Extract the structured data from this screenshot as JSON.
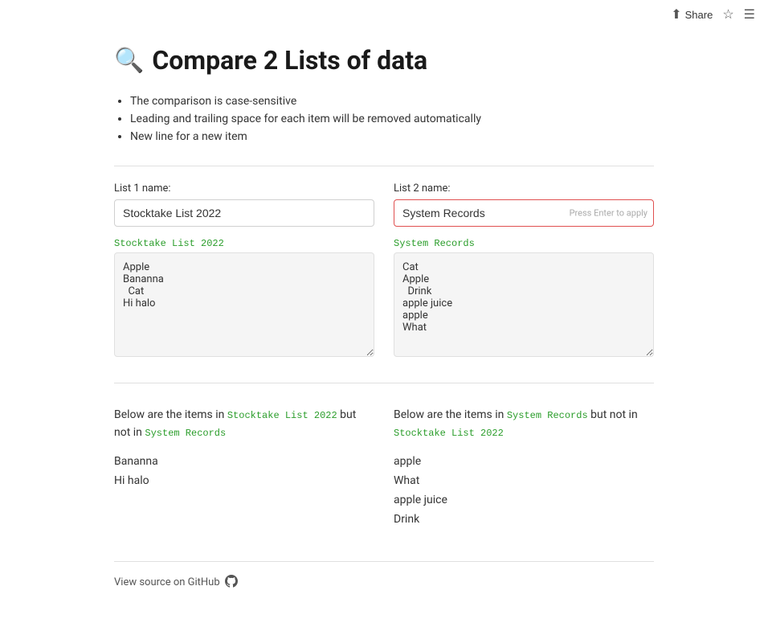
{
  "topbar": {
    "share_label": "Share",
    "share_icon": "⬆",
    "star_icon": "☆",
    "menu_icon": "☰"
  },
  "page": {
    "title_icon": "🔍",
    "title": "Compare 2 Lists of data"
  },
  "instructions": [
    "The comparison is case-sensitive",
    "Leading and trailing space for each item will be removed automatically",
    "New line for a new item"
  ],
  "list1": {
    "label": "List 1 name:",
    "name_value": "Stocktake List 2022",
    "tag": "Stocktake List 2022",
    "textarea_value": "Apple\nBananna\n  Cat\nHi halo"
  },
  "list2": {
    "label": "List 2 name:",
    "name_value": "System Records",
    "tag": "System Records",
    "press_enter": "Press Enter to apply",
    "textarea_value": "Cat\nApple\n  Drink\napple juice\napple\nWhat"
  },
  "results": {
    "col1": {
      "prefix": "Below are the items in",
      "tag1": "Stocktake List 2022",
      "middle": "but",
      "not_in": "not in",
      "tag2": "System Records",
      "items": [
        "Bananna",
        "Hi halo"
      ]
    },
    "col2": {
      "prefix": "Below are the items in",
      "tag1": "System Records",
      "middle": "but not in",
      "tag2": "Stocktake List 2022",
      "items": [
        "apple",
        "What",
        "apple juice",
        "Drink"
      ]
    }
  },
  "footer": {
    "link_text": "View source on GitHub",
    "github_icon": "⬤"
  }
}
